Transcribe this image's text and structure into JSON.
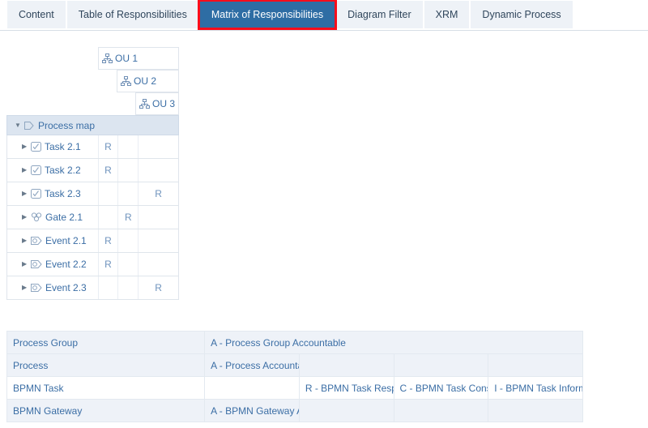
{
  "tabs": [
    {
      "label": "Content",
      "selected": false
    },
    {
      "label": "Table of Responsibilities",
      "selected": false
    },
    {
      "label": "Matrix of Responsibilities",
      "selected": true
    },
    {
      "label": "Diagram Filter",
      "selected": false
    },
    {
      "label": "XRM",
      "selected": false
    },
    {
      "label": "Dynamic Process",
      "selected": false
    }
  ],
  "matrix": {
    "columns": [
      {
        "label": "OU 1",
        "icon": "org-unit-icon"
      },
      {
        "label": "OU 2",
        "icon": "org-unit-icon"
      },
      {
        "label": "OU 3",
        "icon": "org-unit-icon"
      }
    ],
    "group": {
      "label": "Process map",
      "icon": "process-map-icon",
      "expanded": true
    },
    "rows": [
      {
        "label": "Task 2.1",
        "icon": "task-icon",
        "values": [
          "R",
          "",
          ""
        ]
      },
      {
        "label": "Task 2.2",
        "icon": "task-icon",
        "values": [
          "R",
          "",
          ""
        ]
      },
      {
        "label": "Task 2.3",
        "icon": "task-icon",
        "values": [
          "",
          "",
          "R"
        ]
      },
      {
        "label": "Gate 2.1",
        "icon": "gateway-icon",
        "values": [
          "",
          "R",
          ""
        ]
      },
      {
        "label": "Event 2.1",
        "icon": "event-icon",
        "values": [
          "R",
          "",
          ""
        ]
      },
      {
        "label": "Event 2.2",
        "icon": "event-icon",
        "values": [
          "R",
          "",
          ""
        ]
      },
      {
        "label": "Event 2.3",
        "icon": "event-icon",
        "values": [
          "",
          "",
          "R"
        ]
      }
    ]
  },
  "legend": {
    "rows": [
      {
        "shaded": true,
        "key": "Process Group",
        "desc": "A - Process Group Accountable",
        "c1": "",
        "c2": "",
        "c3": "",
        "merged": true
      },
      {
        "shaded": true,
        "key": "Process",
        "desc": "A - Process Accountable",
        "c1": "",
        "c2": "",
        "c3": "",
        "merged": false
      },
      {
        "shaded": false,
        "key": "BPMN Task",
        "desc": "",
        "c1": "R - BPMN Task Responsible",
        "c2": "C - BPMN Task Consulted",
        "c3": "I - BPMN Task Informed",
        "merged": false
      },
      {
        "shaded": true,
        "key": "BPMN Gateway",
        "desc": "A - BPMN Gateway Accountable",
        "c1": "",
        "c2": "",
        "c3": "",
        "merged": false
      }
    ]
  },
  "colors": {
    "tab_selected_bg": "#2e6da4",
    "tab_highlight": "#fc0d1b",
    "tab_bg": "#eef2f7",
    "text_blue": "#3b6ea5",
    "group_row_bg": "#dce5f0",
    "legend_shaded_bg": "#eef2f8",
    "grid_line": "#dfe5ec"
  }
}
